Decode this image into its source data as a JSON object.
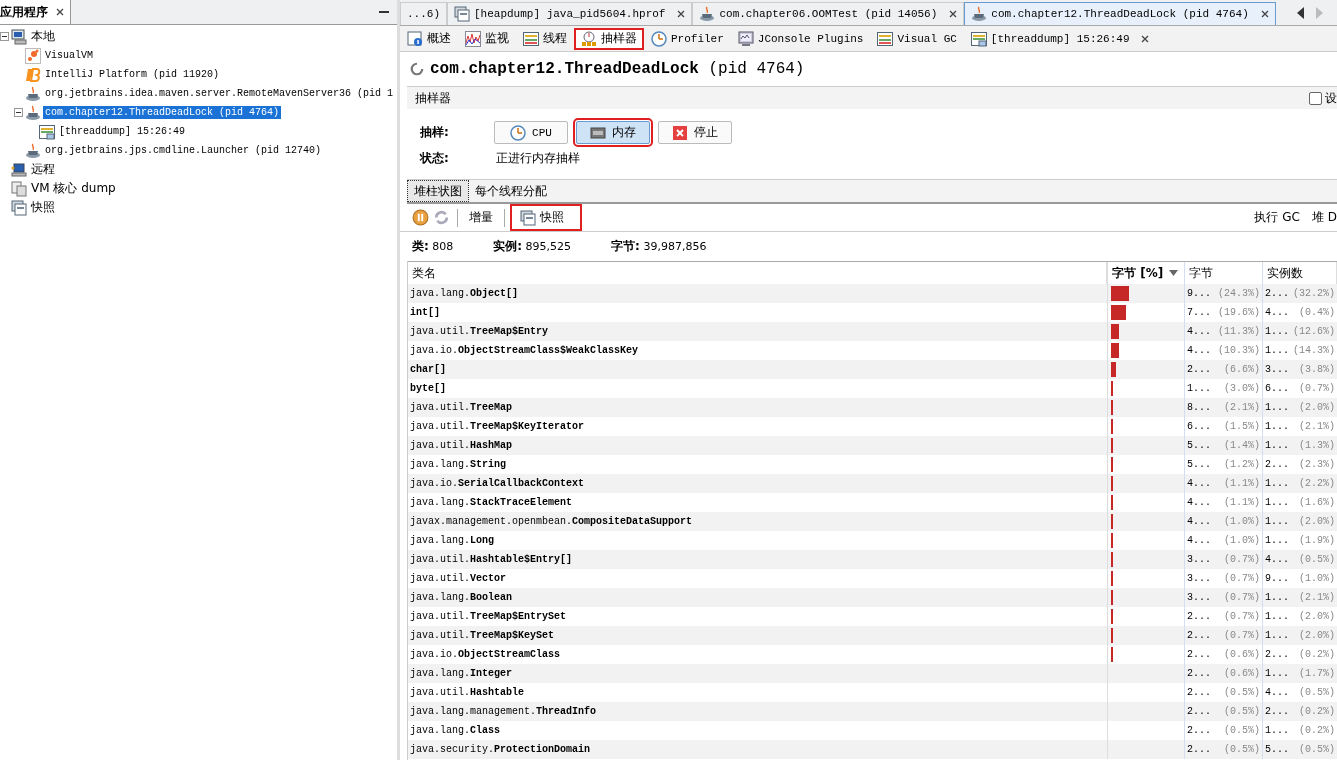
{
  "left_panel": {
    "title": "应用程序",
    "tree": [
      {
        "label": "本地",
        "kind": "computer",
        "selected": false,
        "expanded": true,
        "children": [
          {
            "label": "VisualVM",
            "kind": "visualvm",
            "selected": false
          },
          {
            "label": "IntelliJ Platform (pid 11920)",
            "kind": "intellij",
            "selected": false
          },
          {
            "label": "org.jetbrains.idea.maven.server.RemoteMavenServer36 (pid 1",
            "kind": "java",
            "selected": false
          },
          {
            "label": "com.chapter12.ThreadDeadLock (pid 4764)",
            "kind": "java",
            "selected": true,
            "expanded": true,
            "children": [
              {
                "label": "[threaddump] 15:26:49",
                "kind": "threaddump",
                "selected": false
              }
            ]
          },
          {
            "label": "org.jetbrains.jps.cmdline.Launcher (pid 12740)",
            "kind": "java",
            "selected": false
          }
        ]
      },
      {
        "label": "远程",
        "kind": "remote",
        "selected": false
      },
      {
        "label": "VM 核心 dump",
        "kind": "coredump",
        "selected": false
      },
      {
        "label": "快照",
        "kind": "snapshot",
        "selected": false
      }
    ]
  },
  "doc_tabs": [
    {
      "label": "...6)",
      "kind": "none",
      "closable": false,
      "selected": false
    },
    {
      "label": "[heapdump] java_pid5604.hprof",
      "kind": "heapdump",
      "closable": true,
      "selected": false
    },
    {
      "label": "com.chapter06.OOMTest (pid 14056)",
      "kind": "java",
      "closable": true,
      "selected": false
    },
    {
      "label": "com.chapter12.ThreadDeadLock (pid 4764)",
      "kind": "java",
      "closable": true,
      "selected": true
    }
  ],
  "view_tabs": [
    {
      "label": "概述",
      "kind": "overview",
      "selected": false,
      "highlighted": false,
      "closable": false
    },
    {
      "label": "监视",
      "kind": "monitor",
      "selected": false,
      "highlighted": false,
      "closable": false
    },
    {
      "label": "线程",
      "kind": "threads",
      "selected": false,
      "highlighted": false,
      "closable": false
    },
    {
      "label": "抽样器",
      "kind": "sampler",
      "selected": true,
      "highlighted": true,
      "closable": false
    },
    {
      "label": "Profiler",
      "kind": "clock",
      "selected": false,
      "highlighted": false,
      "closable": false
    },
    {
      "label": "JConsole Plugins",
      "kind": "console",
      "selected": false,
      "highlighted": false,
      "closable": false
    },
    {
      "label": "Visual GC",
      "kind": "threads",
      "selected": false,
      "highlighted": false,
      "closable": false
    },
    {
      "label": "[threaddump] 15:26:49",
      "kind": "threaddump",
      "selected": false,
      "highlighted": false,
      "closable": true
    }
  ],
  "header": {
    "app": "com.chapter12.ThreadDeadLock",
    "pid": "(pid 4764)"
  },
  "section": {
    "title": "抽样器",
    "settings_label": "设",
    "settings_checked": false
  },
  "sampling": {
    "label": "抽样:",
    "buttons": [
      {
        "label": "CPU",
        "kind": "clock",
        "selected": false,
        "highlighted": false
      },
      {
        "label": "内存",
        "kind": "memory",
        "selected": true,
        "highlighted": true
      },
      {
        "label": "停止",
        "kind": "stop",
        "selected": false,
        "highlighted": false
      }
    ],
    "status_label": "状态:",
    "status": "正进行内存抽样"
  },
  "result_tabs": [
    {
      "label": "堆柱状图",
      "selected": true
    },
    {
      "label": "每个线程分配",
      "selected": false
    }
  ],
  "toolbar": {
    "pause_disabled": false,
    "refresh_disabled": true,
    "delta": "增量",
    "snapshot": {
      "label": "快照",
      "highlighted": true
    },
    "gc": "执行 GC",
    "heapdump": "堆 D"
  },
  "stats": [
    {
      "label": "类:",
      "value": "808"
    },
    {
      "label": "实例:",
      "value": "895,525"
    },
    {
      "label": "字节:",
      "value": "39,987,856"
    }
  ],
  "table": {
    "columns": [
      "类名",
      "字节 [%]",
      "字节",
      "实例数"
    ],
    "rows": [
      {
        "pkg": "java.lang.",
        "cls": "Object[]",
        "level": 0.243,
        "bytes": "9...",
        "bytes_pct": "(24.3%)",
        "instances": "2...",
        "instances_pct": "(32.2%)"
      },
      {
        "cls": "int[]",
        "level": 0.196,
        "bytes": "7...",
        "bytes_pct": "(19.6%)",
        "instances": "4...",
        "instances_pct": "(0.4%)"
      },
      {
        "pkg": "java.util.",
        "cls": "TreeMap$Entry",
        "level": 0.113,
        "bytes": "4...",
        "bytes_pct": "(11.3%)",
        "instances": "1...",
        "instances_pct": "(12.6%)"
      },
      {
        "pkg": "java.io.",
        "cls": "ObjectStreamClass$WeakClassKey",
        "level": 0.103,
        "bytes": "4...",
        "bytes_pct": "(10.3%)",
        "instances": "1...",
        "instances_pct": "(14.3%)"
      },
      {
        "cls": "char[]",
        "level": 0.066,
        "bytes": "2...",
        "bytes_pct": "(6.6%)",
        "instances": "3...",
        "instances_pct": "(3.8%)"
      },
      {
        "cls": "byte[]",
        "level": 0.03,
        "bytes": "1...",
        "bytes_pct": "(3.0%)",
        "instances": "6...",
        "instances_pct": "(0.7%)"
      },
      {
        "pkg": "java.util.",
        "cls": "TreeMap",
        "level": 0.021,
        "bytes": "8...",
        "bytes_pct": "(2.1%)",
        "instances": "1...",
        "instances_pct": "(2.0%)"
      },
      {
        "pkg": "java.util.",
        "cls": "TreeMap$KeyIterator",
        "level": 0.015,
        "bytes": "6...",
        "bytes_pct": "(1.5%)",
        "instances": "1...",
        "instances_pct": "(2.1%)"
      },
      {
        "pkg": "java.util.",
        "cls": "HashMap",
        "level": 0.014,
        "bytes": "5...",
        "bytes_pct": "(1.4%)",
        "instances": "1...",
        "instances_pct": "(1.3%)"
      },
      {
        "pkg": "java.lang.",
        "cls": "String",
        "level": 0.012,
        "bytes": "5...",
        "bytes_pct": "(1.2%)",
        "instances": "2...",
        "instances_pct": "(2.3%)"
      },
      {
        "pkg": "java.io.",
        "cls": "SerialCallbackContext",
        "level": 0.011,
        "bytes": "4...",
        "bytes_pct": "(1.1%)",
        "instances": "1...",
        "instances_pct": "(2.2%)"
      },
      {
        "pkg": "java.lang.",
        "cls": "StackTraceElement",
        "level": 0.011,
        "bytes": "4...",
        "bytes_pct": "(1.1%)",
        "instances": "1...",
        "instances_pct": "(1.6%)"
      },
      {
        "pkg": "javax.management.openmbean.",
        "cls": "CompositeDataSupport",
        "level": 0.01,
        "bytes": "4...",
        "bytes_pct": "(1.0%)",
        "instances": "1...",
        "instances_pct": "(2.0%)"
      },
      {
        "pkg": "java.lang.",
        "cls": "Long",
        "level": 0.01,
        "bytes": "4...",
        "bytes_pct": "(1.0%)",
        "instances": "1...",
        "instances_pct": "(1.9%)"
      },
      {
        "pkg": "java.util.",
        "cls": "Hashtable$Entry[]",
        "level": 0.007,
        "bytes": "3...",
        "bytes_pct": "(0.7%)",
        "instances": "4...",
        "instances_pct": "(0.5%)"
      },
      {
        "pkg": "java.util.",
        "cls": "Vector",
        "level": 0.007,
        "bytes": "3...",
        "bytes_pct": "(0.7%)",
        "instances": "9...",
        "instances_pct": "(1.0%)"
      },
      {
        "pkg": "java.lang.",
        "cls": "Boolean",
        "level": 0.007,
        "bytes": "3...",
        "bytes_pct": "(0.7%)",
        "instances": "1...",
        "instances_pct": "(2.1%)"
      },
      {
        "pkg": "java.util.",
        "cls": "TreeMap$EntrySet",
        "level": 0.007,
        "bytes": "2...",
        "bytes_pct": "(0.7%)",
        "instances": "1...",
        "instances_pct": "(2.0%)"
      },
      {
        "pkg": "java.util.",
        "cls": "TreeMap$KeySet",
        "level": 0.007,
        "bytes": "2...",
        "bytes_pct": "(0.7%)",
        "instances": "1...",
        "instances_pct": "(2.0%)"
      },
      {
        "pkg": "java.io.",
        "cls": "ObjectStreamClass",
        "level": 0.006,
        "bytes": "2...",
        "bytes_pct": "(0.6%)",
        "instances": "2...",
        "instances_pct": "(0.2%)"
      },
      {
        "pkg": "java.lang.",
        "cls": "Integer",
        "bytes": "2...",
        "bytes_pct": "(0.6%)",
        "instances": "1...",
        "instances_pct": "(1.7%)"
      },
      {
        "pkg": "java.util.",
        "cls": "Hashtable",
        "bytes": "2...",
        "bytes_pct": "(0.5%)",
        "instances": "4...",
        "instances_pct": "(0.5%)"
      },
      {
        "pkg": "java.lang.management.",
        "cls": "ThreadInfo",
        "bytes": "2...",
        "bytes_pct": "(0.5%)",
        "instances": "2...",
        "instances_pct": "(0.2%)"
      },
      {
        "pkg": "java.lang.",
        "cls": "Class",
        "bytes": "2...",
        "bytes_pct": "(0.5%)",
        "instances": "1...",
        "instances_pct": "(0.2%)"
      },
      {
        "pkg": "java.security.",
        "cls": "ProtectionDomain",
        "bytes": "2...",
        "bytes_pct": "(0.5%)",
        "instances": "5...",
        "instances_pct": "(0.5%)"
      }
    ]
  }
}
